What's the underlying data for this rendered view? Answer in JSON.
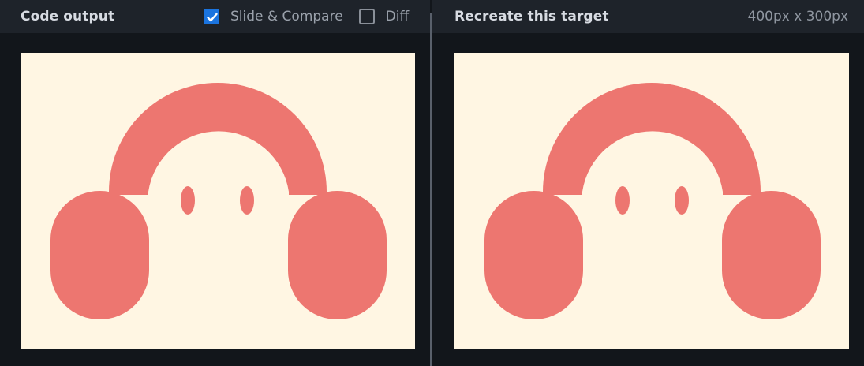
{
  "left_panel": {
    "title": "Code output",
    "slide_compare": {
      "label": "Slide & Compare",
      "checked": true
    },
    "diff": {
      "label": "Diff",
      "checked": false
    }
  },
  "right_panel": {
    "title": "Recreate this target",
    "size_readout": "400px x 300px"
  },
  "colors": {
    "canvas_bg": "#fff6e3",
    "shape": "#ed7670",
    "app_bg": "#12161b",
    "header_bg": "#1e232a",
    "accent": "#1b74df"
  },
  "icons": {
    "checkmark": "check-icon",
    "artwork": "headphones-face-illustration"
  }
}
